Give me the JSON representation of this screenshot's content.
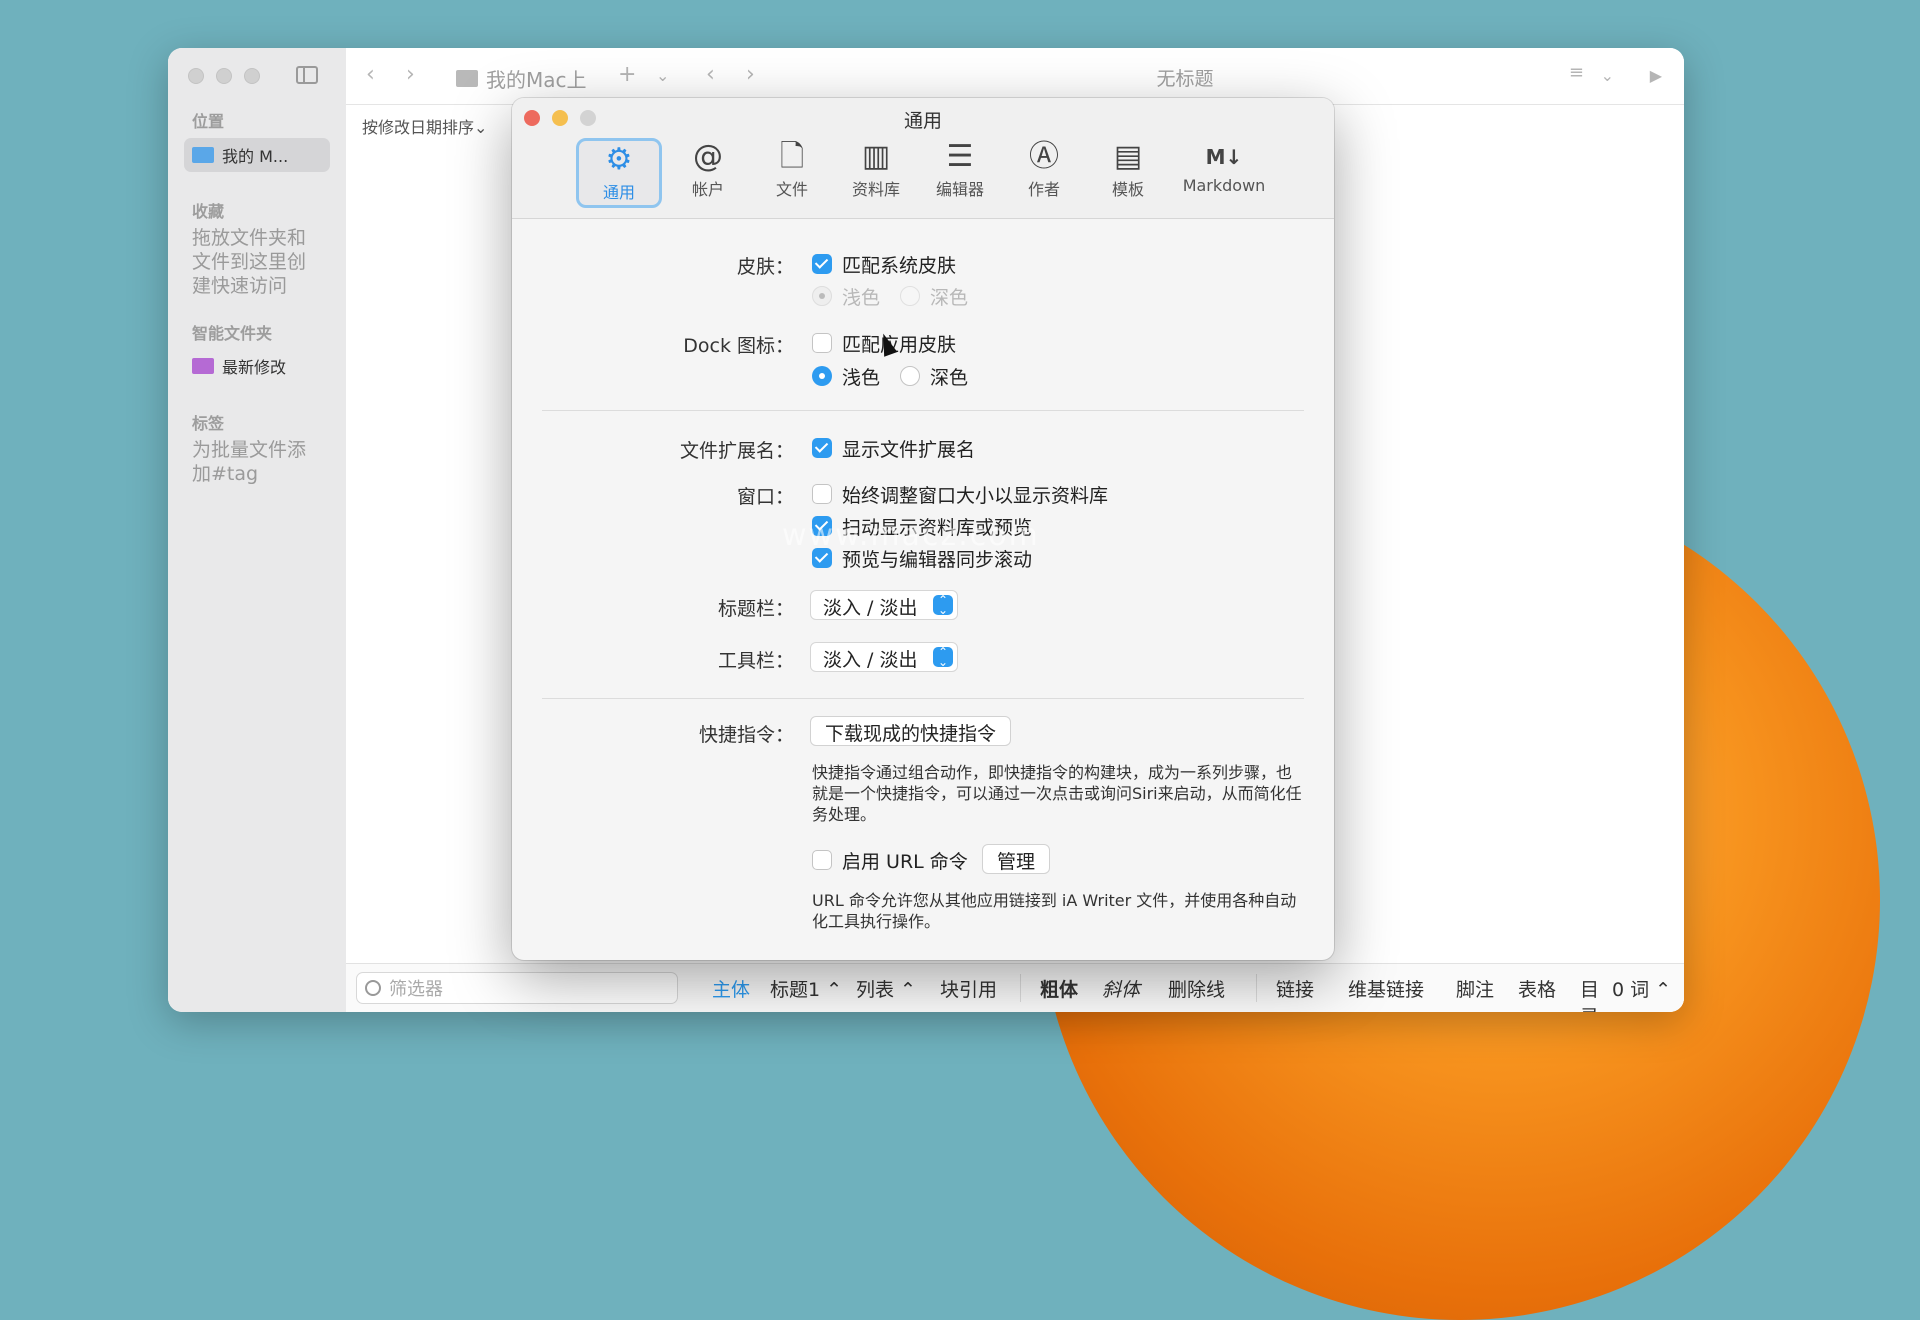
{
  "window": {
    "location": "我的Mac上",
    "editor_title": "无标题",
    "sort_label": "按修改日期排序⌄"
  },
  "sidebar": {
    "section_location": "位置",
    "item_mymac": "我的 M...",
    "section_favorites": "收藏",
    "favorites_hint": "拖放文件夹和文件到这里创建快速访问",
    "section_smart": "智能文件夹",
    "smart_recent": "最新修改",
    "section_tags": "标签",
    "tags_hint": "为批量文件添加#tag"
  },
  "bottom_bar": {
    "filter_placeholder": "筛选器",
    "items": [
      "主体",
      "标题1 ⌃",
      "列表 ⌃",
      "块引用",
      "粗体",
      "斜体",
      "删除线",
      "链接",
      "维基链接",
      "脚注",
      "表格",
      "目录",
      "0 词 ⌃"
    ]
  },
  "prefs": {
    "title": "通用",
    "tabs": [
      {
        "label": "通用",
        "icon": "gear-icon"
      },
      {
        "label": "帐户",
        "icon": "at-icon"
      },
      {
        "label": "文件",
        "icon": "file-add-icon"
      },
      {
        "label": "资料库",
        "icon": "library-icon"
      },
      {
        "label": "编辑器",
        "icon": "editor-icon"
      },
      {
        "label": "作者",
        "icon": "author-icon"
      },
      {
        "label": "模板",
        "icon": "template-icon"
      },
      {
        "label": "Markdown",
        "icon": "markdown-icon"
      }
    ],
    "skin_label": "皮肤：",
    "skin_match": "匹配系统皮肤",
    "skin_light": "浅色",
    "skin_dark": "深色",
    "dock_label": "Dock 图标：",
    "dock_match": "匹配应用皮肤",
    "dock_light": "浅色",
    "dock_dark": "深色",
    "ext_label": "文件扩展名：",
    "ext_show": "显示文件扩展名",
    "window_label": "窗口：",
    "window_opt1": "始终调整窗口大小以显示资料库",
    "window_opt2": "扫动显示资料库或预览",
    "window_opt3": "预览与编辑器同步滚动",
    "titlebar_label": "标题栏：",
    "titlebar_value": "淡入 / 淡出",
    "toolbar_label": "工具栏：",
    "toolbar_value": "淡入 / 淡出",
    "shortcuts_label": "快捷指令：",
    "shortcuts_button": "下载现成的快捷指令",
    "shortcuts_desc": "快捷指令通过组合动作，即快捷指令的构建块，成为一系列步骤，也就是一个快捷指令，可以通过一次点击或询问Siri来启动，从而简化任务处理。",
    "url_enable": "启用 URL 命令",
    "url_manage": "管理",
    "url_desc": "URL 命令允许您从其他应用链接到 iA Writer 文件，并使用各种自动化工具执行操作。"
  },
  "watermark": "www.macz.com",
  "colors": {
    "accent": "#2d9bf0",
    "background": "#6fb1bd",
    "orange": "#f7931e"
  }
}
